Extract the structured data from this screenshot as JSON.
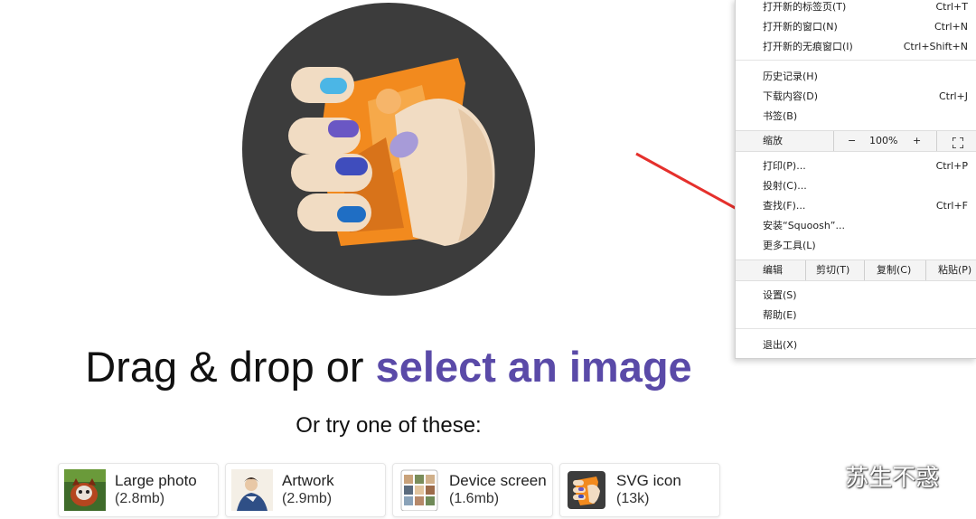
{
  "hero": {
    "headline_plain": "Drag & drop or ",
    "headline_link": "select an image",
    "subline": "Or try one of these:"
  },
  "samples": [
    {
      "title": "Large photo",
      "size": "(2.8mb)",
      "icon": "red-panda-photo"
    },
    {
      "title": "Artwork",
      "size": "(2.9mb)",
      "icon": "artwork-painting"
    },
    {
      "title": "Device screen",
      "size": "(1.6mb)",
      "icon": "phone-screenshot"
    },
    {
      "title": "SVG icon",
      "size": "(13k)",
      "icon": "squoosh-logo"
    }
  ],
  "menu": {
    "items_top": [
      {
        "label": "打开新的标签页(T)",
        "shortcut": "Ctrl+T"
      },
      {
        "label": "打开新的窗口(N)",
        "shortcut": "Ctrl+N"
      },
      {
        "label": "打开新的无痕窗口(I)",
        "shortcut": "Ctrl+Shift+N"
      }
    ],
    "items_history": [
      {
        "label": "历史记录(H)",
        "shortcut": ""
      },
      {
        "label": "下载内容(D)",
        "shortcut": "Ctrl+J"
      },
      {
        "label": "书签(B)",
        "shortcut": ""
      }
    ],
    "zoom": {
      "label": "缩放",
      "minus": "−",
      "value": "100%",
      "plus": "+"
    },
    "items_tools": [
      {
        "label": "打印(P)...",
        "shortcut": "Ctrl+P"
      },
      {
        "label": "投射(C)...",
        "shortcut": ""
      },
      {
        "label": "查找(F)...",
        "shortcut": "Ctrl+F"
      },
      {
        "label": "安装“Squoosh”...",
        "shortcut": ""
      },
      {
        "label": "更多工具(L)",
        "shortcut": ""
      }
    ],
    "edit": {
      "label": "编辑",
      "cut": "剪切(T)",
      "copy": "复制(C)",
      "paste": "粘贴(P)"
    },
    "items_bottom": [
      {
        "label": "设置(S)",
        "shortcut": ""
      },
      {
        "label": "帮助(E)",
        "shortcut": ""
      }
    ],
    "exit": {
      "label": "退出(X)"
    }
  },
  "watermark": {
    "text": "苏生不惑"
  },
  "colors": {
    "link_purple": "#5a4aa8",
    "circle_dark": "#3c3c3c",
    "orange": "#f28a1e",
    "arrow_red": "#e5302c"
  }
}
